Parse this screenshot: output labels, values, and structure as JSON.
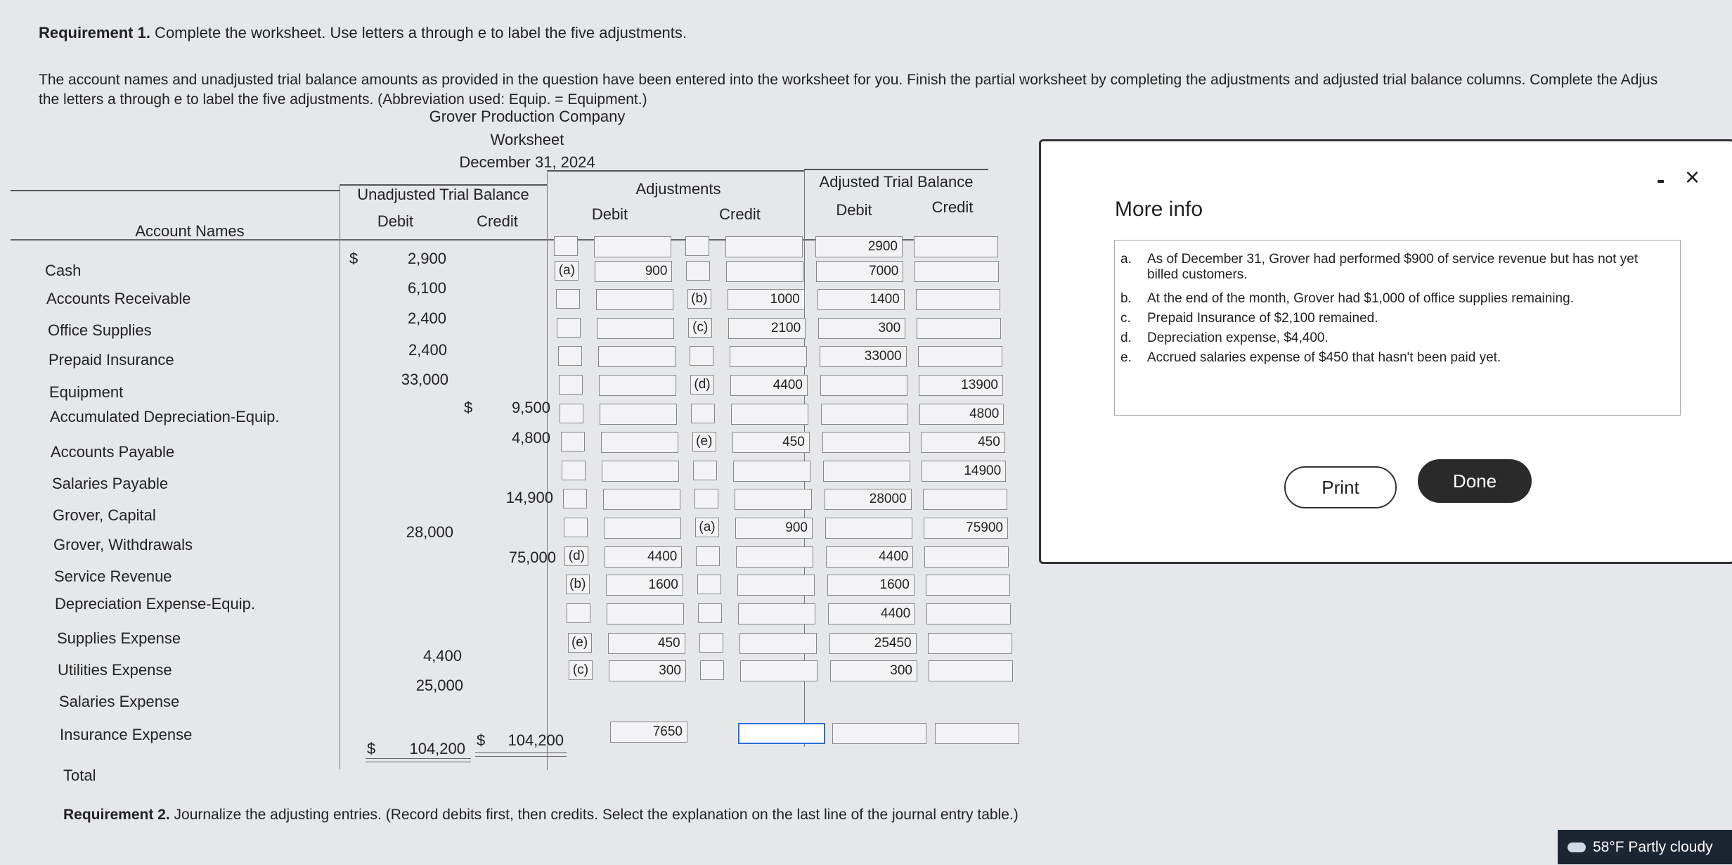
{
  "requirement1": {
    "label": "Requirement 1.",
    "text": " Complete the worksheet. Use letters a through e to label the five adjustments."
  },
  "instructions": {
    "line1": "The account names and unadjusted trial balance amounts as provided in the question have been entered into the worksheet for you. Finish the partial worksheet by completing the adjustments and adjusted trial balance columns. Complete the Adjus",
    "line2": "the letters a through e to label the five adjustments. (Abbreviation used: Equip. = Equipment.)"
  },
  "header": {
    "company": "Grover Production Company",
    "title": "Worksheet",
    "date": "December 31, 2024"
  },
  "columns": {
    "account_names": "Account Names",
    "unadjusted": "Unadjusted Trial Balance",
    "adjustments": "Adjustments",
    "adjusted": "Adjusted Trial Balance",
    "debit": "Debit",
    "credit": "Credit"
  },
  "accounts": [
    {
      "name": "Cash",
      "ut_debit": "2,900",
      "ut_credit": "",
      "adj_label_d": "",
      "adj_debit": "",
      "adj_label_c": "",
      "adj_credit": "",
      "atb_debit": "2900",
      "atb_credit": ""
    },
    {
      "name": "Accounts Receivable",
      "ut_debit": "6,100",
      "ut_credit": "",
      "adj_label_d": "(a)",
      "adj_debit": "900",
      "adj_label_c": "",
      "adj_credit": "",
      "atb_debit": "7000",
      "atb_credit": ""
    },
    {
      "name": "Office Supplies",
      "ut_debit": "2,400",
      "ut_credit": "",
      "adj_label_d": "",
      "adj_debit": "",
      "adj_label_c": "(b)",
      "adj_credit": "1000",
      "atb_debit": "1400",
      "atb_credit": ""
    },
    {
      "name": "Prepaid Insurance",
      "ut_debit": "2,400",
      "ut_credit": "",
      "adj_label_d": "",
      "adj_debit": "",
      "adj_label_c": "(c)",
      "adj_credit": "2100",
      "atb_debit": "300",
      "atb_credit": ""
    },
    {
      "name": "Equipment",
      "ut_debit": "33,000",
      "ut_credit": "",
      "adj_label_d": "",
      "adj_debit": "",
      "adj_label_c": "",
      "adj_credit": "",
      "atb_debit": "33000",
      "atb_credit": ""
    },
    {
      "name": "Accumulated Depreciation-Equip.",
      "ut_debit": "",
      "ut_credit": "9,500",
      "adj_label_d": "",
      "adj_debit": "",
      "adj_label_c": "(d)",
      "adj_credit": "4400",
      "atb_debit": "",
      "atb_credit": "13900"
    },
    {
      "name": "Accounts Payable",
      "ut_debit": "",
      "ut_credit": "4,800",
      "adj_label_d": "",
      "adj_debit": "",
      "adj_label_c": "",
      "adj_credit": "",
      "atb_debit": "",
      "atb_credit": "4800"
    },
    {
      "name": "Salaries Payable",
      "ut_debit": "",
      "ut_credit": "",
      "adj_label_d": "",
      "adj_debit": "",
      "adj_label_c": "(e)",
      "adj_credit": "450",
      "atb_debit": "",
      "atb_credit": "450"
    },
    {
      "name": "Grover, Capital",
      "ut_debit": "",
      "ut_credit": "14,900",
      "adj_label_d": "",
      "adj_debit": "",
      "adj_label_c": "",
      "adj_credit": "",
      "atb_debit": "",
      "atb_credit": "14900"
    },
    {
      "name": "Grover, Withdrawals",
      "ut_debit": "28,000",
      "ut_credit": "",
      "adj_label_d": "",
      "adj_debit": "",
      "adj_label_c": "",
      "adj_credit": "",
      "atb_debit": "28000",
      "atb_credit": ""
    },
    {
      "name": "Service Revenue",
      "ut_debit": "",
      "ut_credit": "75,000",
      "adj_label_d": "",
      "adj_debit": "",
      "adj_label_c": "(a)",
      "adj_credit": "900",
      "atb_debit": "",
      "atb_credit": "75900"
    },
    {
      "name": "Depreciation Expense-Equip.",
      "ut_debit": "",
      "ut_credit": "",
      "adj_label_d": "(d)",
      "adj_debit": "4400",
      "adj_label_c": "",
      "adj_credit": "",
      "atb_debit": "4400",
      "atb_credit": ""
    },
    {
      "name": "Supplies Expense",
      "ut_debit": "",
      "ut_credit": "",
      "adj_label_d": "(b)",
      "adj_debit": "1600",
      "adj_label_c": "",
      "adj_credit": "",
      "atb_debit": "1600",
      "atb_credit": ""
    },
    {
      "name": "Utilities Expense",
      "ut_debit": "4,400",
      "ut_credit": "",
      "adj_label_d": "",
      "adj_debit": "",
      "adj_label_c": "",
      "adj_credit": "",
      "atb_debit": "4400",
      "atb_credit": ""
    },
    {
      "name": "Salaries Expense",
      "ut_debit": "25,000",
      "ut_credit": "",
      "adj_label_d": "(e)",
      "adj_debit": "450",
      "adj_label_c": "",
      "adj_credit": "",
      "atb_debit": "25450",
      "atb_credit": ""
    },
    {
      "name": "Insurance Expense",
      "ut_debit": "",
      "ut_credit": "",
      "adj_label_d": "(c)",
      "adj_debit": "300",
      "adj_label_c": "",
      "adj_credit": "",
      "atb_debit": "300",
      "atb_credit": ""
    }
  ],
  "totals": {
    "label": "Total",
    "ut_debit": "104,200",
    "ut_credit": "104,200",
    "adj_debit": "7650",
    "adj_credit": "",
    "atb_debit": "",
    "atb_credit": "",
    "currency": "$"
  },
  "requirement2": {
    "label": "Requirement 2.",
    "text": " Journalize the adjusting entries. (Record debits first, then credits. Select the explanation on the last line of the journal entry table.)"
  },
  "dialog": {
    "title": "More info",
    "minimize": "-",
    "close": "×",
    "items": [
      {
        "key": "a.",
        "text": "As of December 31, Grover had performed $900 of service revenue but has not yet billed customers."
      },
      {
        "key": "b.",
        "text": "At the end of the month, Grover had $1,000 of office supplies remaining."
      },
      {
        "key": "c.",
        "text": "Prepaid Insurance of $2,100 remained."
      },
      {
        "key": "d.",
        "text": "Depreciation expense, $4,400."
      },
      {
        "key": "e.",
        "text": "Accrued salaries expense of $450 that hasn't been paid yet."
      }
    ],
    "print_label": "Print",
    "done_label": "Done"
  },
  "taskbar": {
    "weather": "58°F  Partly cloudy"
  }
}
